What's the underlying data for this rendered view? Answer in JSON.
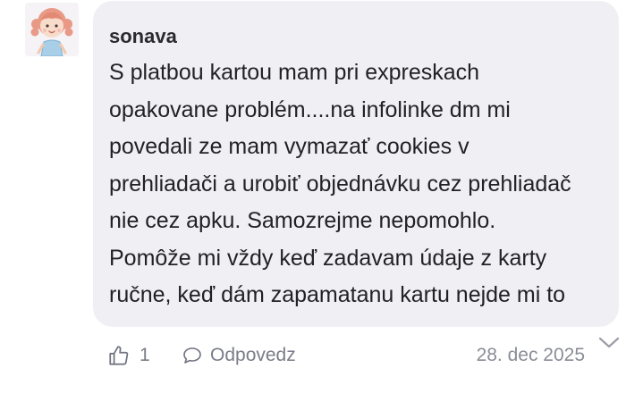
{
  "comment": {
    "author": "sonava",
    "avatar_icon": "girl-avatar-icon",
    "text_lines": [
      "S platbou kartou mam pri expreskach",
      "opakovane problém....na infolinke dm mi",
      "povedali ze mam vymazať cookies v",
      "prehliadači a urobiť objednávku cez prehliadač",
      "nie cez apku. Samozrejme nepomohlo.",
      "Pomôže mi vždy keď zadavam údaje z karty",
      "ručne, keď dám zapamatanu kartu nejde mi to"
    ],
    "likes": "1",
    "reply_label": "Odpovedz",
    "date": "28. dec 2025"
  },
  "icons": {
    "like": "thumbs-up-icon",
    "reply": "speech-bubble-icon",
    "expand": "chevron-down-icon"
  },
  "colors": {
    "bubble_background": "#f0f0f4",
    "text": "#222226",
    "muted": "#7a7d88"
  }
}
